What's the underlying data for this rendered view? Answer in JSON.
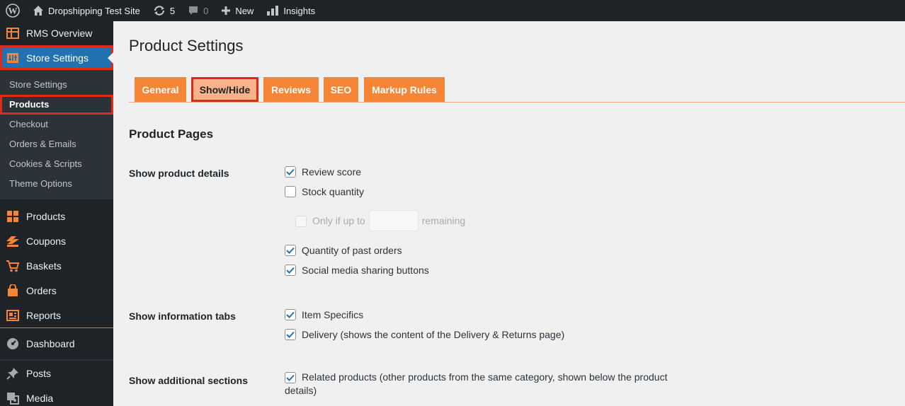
{
  "admin_bar": {
    "site_name": "Dropshipping Test Site",
    "updates_count": "5",
    "comments_count": "0",
    "new_label": "New",
    "insights_label": "Insights"
  },
  "sidebar": {
    "rms_overview": "RMS Overview",
    "store_settings": "Store Settings",
    "submenu": [
      "Store Settings",
      "Products",
      "Checkout",
      "Orders & Emails",
      "Cookies & Scripts",
      "Theme Options"
    ],
    "shop_items": [
      "Products",
      "Coupons",
      "Baskets",
      "Orders",
      "Reports"
    ],
    "dashboard": "Dashboard",
    "posts": "Posts",
    "media": "Media"
  },
  "page": {
    "title": "Product Settings",
    "tabs": [
      "General",
      "Show/Hide",
      "Reviews",
      "SEO",
      "Markup Rules"
    ],
    "active_tab": "Show/Hide",
    "section_title": "Product Pages",
    "groups": {
      "details": {
        "label": "Show product details",
        "options": [
          {
            "label": "Review score",
            "checked": true
          },
          {
            "label": "Stock quantity",
            "checked": false
          },
          {
            "label": "Quantity of past orders",
            "checked": true
          },
          {
            "label": "Social media sharing buttons",
            "checked": true
          }
        ],
        "sub_option": {
          "prefix": "Only if up to",
          "suffix": "remaining",
          "value": "",
          "checked": false,
          "disabled": true
        }
      },
      "tabs": {
        "label": "Show information tabs",
        "options": [
          {
            "label": "Item Specifics",
            "checked": true
          },
          {
            "label": "Delivery (shows the content of the Delivery & Returns page)",
            "checked": true
          }
        ]
      },
      "additional": {
        "label": "Show additional sections",
        "options": [
          {
            "label": "Related products (other products from the same category, shown below the product details)",
            "checked": true
          }
        ]
      }
    }
  },
  "colors": {
    "accent": "#f68535",
    "active_tab": "#f9b28a",
    "highlight": "#e02a16",
    "wp_blue": "#2271b1",
    "admin_dark": "#1d2327"
  }
}
